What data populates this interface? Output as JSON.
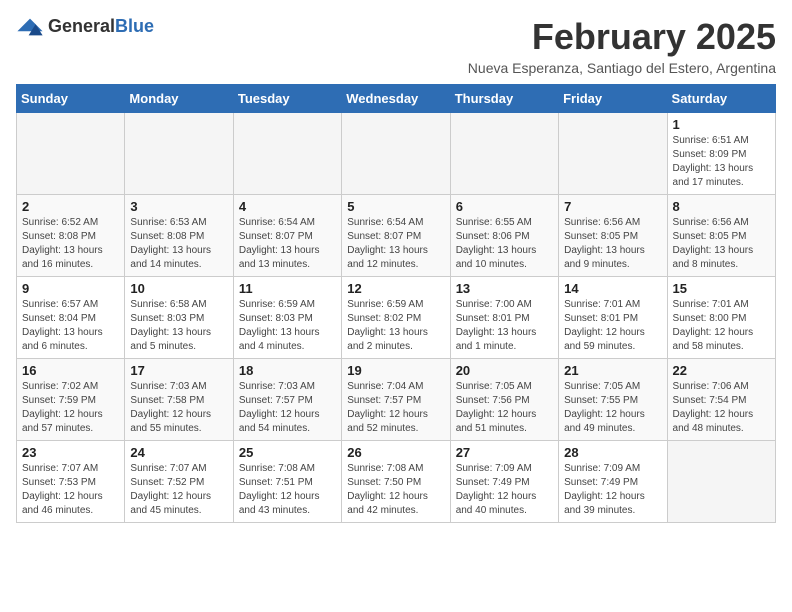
{
  "logo": {
    "general": "General",
    "blue": "Blue"
  },
  "title": "February 2025",
  "subtitle": "Nueva Esperanza, Santiago del Estero, Argentina",
  "days_of_week": [
    "Sunday",
    "Monday",
    "Tuesday",
    "Wednesday",
    "Thursday",
    "Friday",
    "Saturday"
  ],
  "weeks": [
    [
      {
        "day": "",
        "info": ""
      },
      {
        "day": "",
        "info": ""
      },
      {
        "day": "",
        "info": ""
      },
      {
        "day": "",
        "info": ""
      },
      {
        "day": "",
        "info": ""
      },
      {
        "day": "",
        "info": ""
      },
      {
        "day": "1",
        "info": "Sunrise: 6:51 AM\nSunset: 8:09 PM\nDaylight: 13 hours and 17 minutes."
      }
    ],
    [
      {
        "day": "2",
        "info": "Sunrise: 6:52 AM\nSunset: 8:08 PM\nDaylight: 13 hours and 16 minutes."
      },
      {
        "day": "3",
        "info": "Sunrise: 6:53 AM\nSunset: 8:08 PM\nDaylight: 13 hours and 14 minutes."
      },
      {
        "day": "4",
        "info": "Sunrise: 6:54 AM\nSunset: 8:07 PM\nDaylight: 13 hours and 13 minutes."
      },
      {
        "day": "5",
        "info": "Sunrise: 6:54 AM\nSunset: 8:07 PM\nDaylight: 13 hours and 12 minutes."
      },
      {
        "day": "6",
        "info": "Sunrise: 6:55 AM\nSunset: 8:06 PM\nDaylight: 13 hours and 10 minutes."
      },
      {
        "day": "7",
        "info": "Sunrise: 6:56 AM\nSunset: 8:05 PM\nDaylight: 13 hours and 9 minutes."
      },
      {
        "day": "8",
        "info": "Sunrise: 6:56 AM\nSunset: 8:05 PM\nDaylight: 13 hours and 8 minutes."
      }
    ],
    [
      {
        "day": "9",
        "info": "Sunrise: 6:57 AM\nSunset: 8:04 PM\nDaylight: 13 hours and 6 minutes."
      },
      {
        "day": "10",
        "info": "Sunrise: 6:58 AM\nSunset: 8:03 PM\nDaylight: 13 hours and 5 minutes."
      },
      {
        "day": "11",
        "info": "Sunrise: 6:59 AM\nSunset: 8:03 PM\nDaylight: 13 hours and 4 minutes."
      },
      {
        "day": "12",
        "info": "Sunrise: 6:59 AM\nSunset: 8:02 PM\nDaylight: 13 hours and 2 minutes."
      },
      {
        "day": "13",
        "info": "Sunrise: 7:00 AM\nSunset: 8:01 PM\nDaylight: 13 hours and 1 minute."
      },
      {
        "day": "14",
        "info": "Sunrise: 7:01 AM\nSunset: 8:01 PM\nDaylight: 12 hours and 59 minutes."
      },
      {
        "day": "15",
        "info": "Sunrise: 7:01 AM\nSunset: 8:00 PM\nDaylight: 12 hours and 58 minutes."
      }
    ],
    [
      {
        "day": "16",
        "info": "Sunrise: 7:02 AM\nSunset: 7:59 PM\nDaylight: 12 hours and 57 minutes."
      },
      {
        "day": "17",
        "info": "Sunrise: 7:03 AM\nSunset: 7:58 PM\nDaylight: 12 hours and 55 minutes."
      },
      {
        "day": "18",
        "info": "Sunrise: 7:03 AM\nSunset: 7:57 PM\nDaylight: 12 hours and 54 minutes."
      },
      {
        "day": "19",
        "info": "Sunrise: 7:04 AM\nSunset: 7:57 PM\nDaylight: 12 hours and 52 minutes."
      },
      {
        "day": "20",
        "info": "Sunrise: 7:05 AM\nSunset: 7:56 PM\nDaylight: 12 hours and 51 minutes."
      },
      {
        "day": "21",
        "info": "Sunrise: 7:05 AM\nSunset: 7:55 PM\nDaylight: 12 hours and 49 minutes."
      },
      {
        "day": "22",
        "info": "Sunrise: 7:06 AM\nSunset: 7:54 PM\nDaylight: 12 hours and 48 minutes."
      }
    ],
    [
      {
        "day": "23",
        "info": "Sunrise: 7:07 AM\nSunset: 7:53 PM\nDaylight: 12 hours and 46 minutes."
      },
      {
        "day": "24",
        "info": "Sunrise: 7:07 AM\nSunset: 7:52 PM\nDaylight: 12 hours and 45 minutes."
      },
      {
        "day": "25",
        "info": "Sunrise: 7:08 AM\nSunset: 7:51 PM\nDaylight: 12 hours and 43 minutes."
      },
      {
        "day": "26",
        "info": "Sunrise: 7:08 AM\nSunset: 7:50 PM\nDaylight: 12 hours and 42 minutes."
      },
      {
        "day": "27",
        "info": "Sunrise: 7:09 AM\nSunset: 7:49 PM\nDaylight: 12 hours and 40 minutes."
      },
      {
        "day": "28",
        "info": "Sunrise: 7:09 AM\nSunset: 7:49 PM\nDaylight: 12 hours and 39 minutes."
      },
      {
        "day": "",
        "info": ""
      }
    ]
  ]
}
